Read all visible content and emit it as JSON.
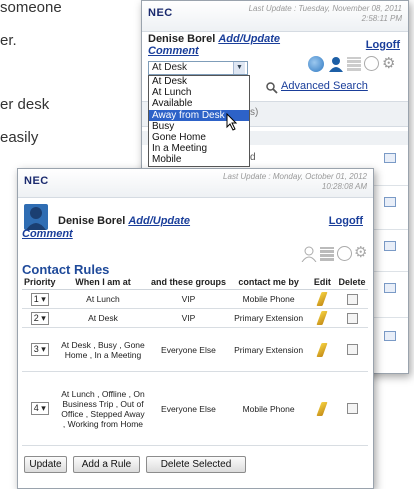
{
  "background_text": {
    "line1": "someone",
    "line2": "er.",
    "line3": "er desk",
    "line4": "easily"
  },
  "back_window": {
    "logo": "NEC",
    "last_update": "Last Update :  Tuesday, November 08, 2011",
    "last_update_time": "2:58:11 PM",
    "user_name": "Denise Borel",
    "add_update_comment": "Add/Update",
    "comment": "Comment",
    "logoff": "Logoff",
    "status_selected": "At Desk",
    "advanced_search": "Advanced Search",
    "status_options": [
      "At Desk",
      "At Lunch",
      "Available",
      "Away from Desk",
      "Busy",
      "Gone Home",
      "In a Meeting",
      "Mobile"
    ],
    "highlighted_option": "Away from Desk",
    "partial_text_1": "s)",
    "partial_text_2": "d"
  },
  "front_window": {
    "logo": "NEC",
    "last_update": "Last Update :  Monday, October 01, 2012",
    "last_update_time": "10:28:08 AM",
    "user_name": "Denise Borel",
    "add_update": "Add/Update",
    "comment": "Comment",
    "logoff": "Logoff",
    "section_title": "Contact Rules",
    "table": {
      "headers": [
        "Priority",
        "When I am at",
        "and these groups",
        "contact me by",
        "Edit",
        "Delete"
      ],
      "rows": [
        {
          "priority": "1",
          "when": "At Lunch",
          "groups": "VIP",
          "contact": "Mobile Phone"
        },
        {
          "priority": "2",
          "when": "At Desk",
          "groups": "VIP",
          "contact": "Primary Extension"
        },
        {
          "priority": "3",
          "when": "At Desk , Busy , Gone Home , In a Meeting",
          "groups": "Everyone Else",
          "contact": "Primary Extension"
        },
        {
          "priority": "4",
          "when": "At Lunch , Offline , On Business Trip , Out of Office , Stepped Away , Working from Home",
          "groups": "Everyone Else",
          "contact": "Mobile Phone"
        }
      ]
    },
    "buttons": {
      "update": "Update",
      "add_rule": "Add a Rule",
      "delete_selected": "Delete Selected"
    }
  }
}
